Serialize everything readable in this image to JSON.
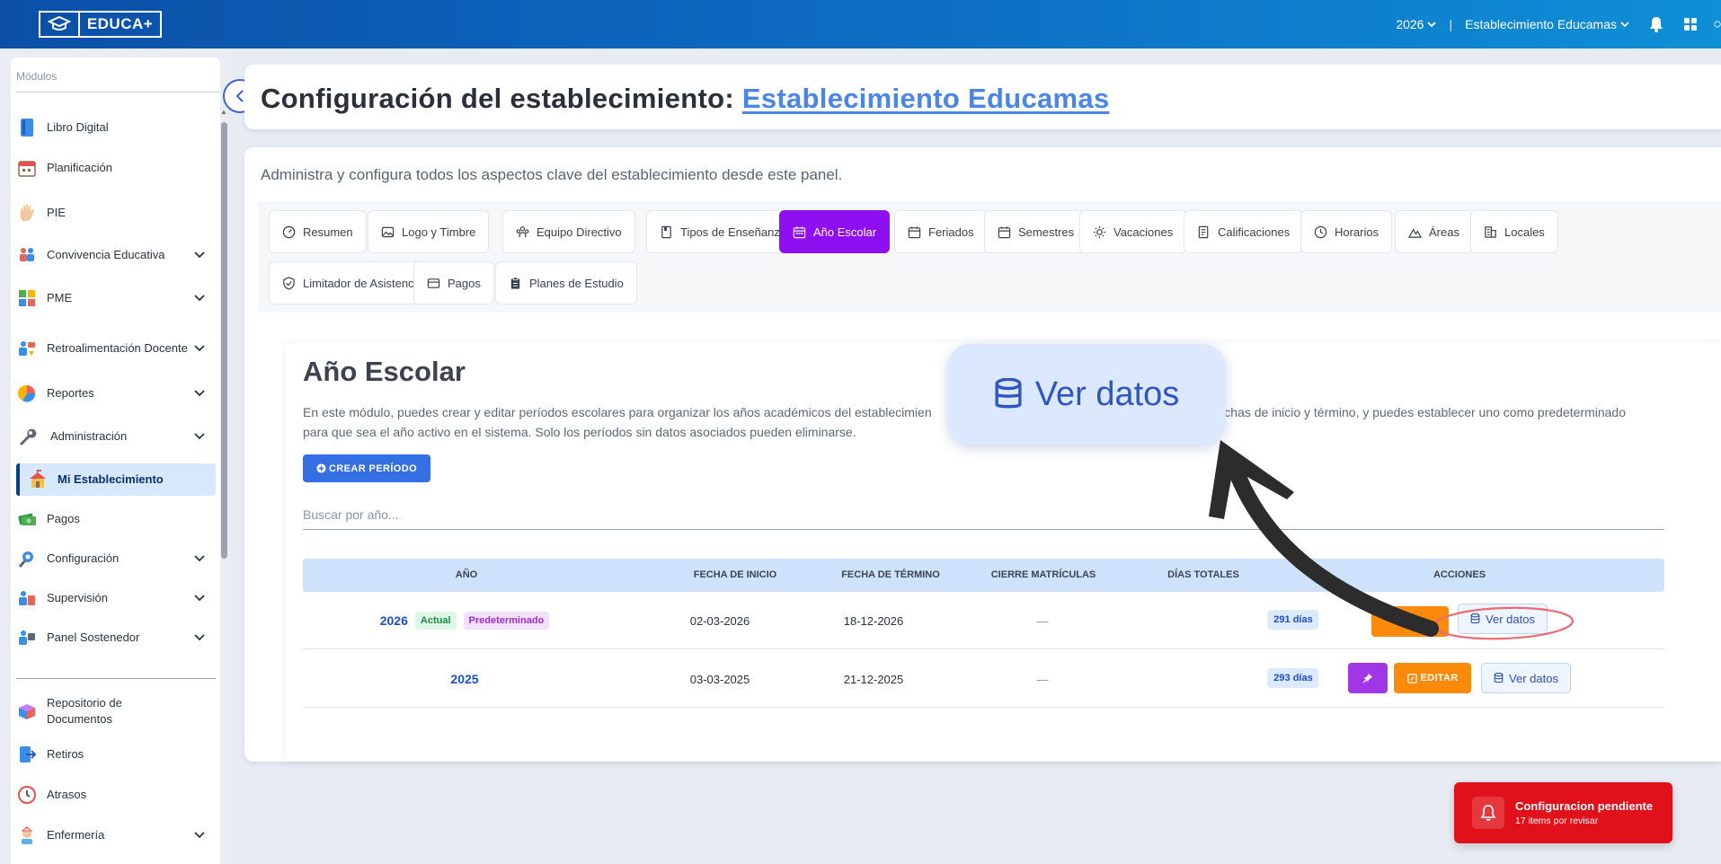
{
  "topbar": {
    "logo_text": "EDUCA+",
    "year": "2026",
    "separator": "|",
    "establishment": "Establecimiento Educamas"
  },
  "sidebar": {
    "section_title": "Módulos",
    "items": [
      {
        "label": "Libro Digital",
        "icon": "book-icon",
        "chevron": false
      },
      {
        "label": "Planificación",
        "icon": "calendar-icon",
        "chevron": false
      },
      {
        "label": "PIE",
        "icon": "hand-icon",
        "chevron": false
      },
      {
        "label": "Convivencia Educativa",
        "icon": "people-icon",
        "chevron": true
      },
      {
        "label": "PME",
        "icon": "blocks-icon",
        "chevron": true
      },
      {
        "label": "Retroalimentación Docente",
        "icon": "feedback-icon",
        "chevron": true
      },
      {
        "label": "Reportes",
        "icon": "pie-chart-icon",
        "chevron": true
      },
      {
        "label": "Administración",
        "icon": "wrench-icon",
        "chevron": true
      },
      {
        "label": "Mi Establecimiento",
        "icon": "school-icon",
        "chevron": false,
        "active": true
      },
      {
        "label": "Pagos",
        "icon": "money-icon",
        "chevron": false
      },
      {
        "label": "Configuración",
        "icon": "config-icon",
        "chevron": true
      },
      {
        "label": "Supervisión",
        "icon": "supervision-icon",
        "chevron": true
      },
      {
        "label": "Panel Sostenedor",
        "icon": "panel-icon",
        "chevron": true
      },
      {
        "label": "Repositorio de Documentos",
        "icon": "box-icon",
        "chevron": false
      },
      {
        "label": "Retiros",
        "icon": "exit-icon",
        "chevron": false
      },
      {
        "label": "Atrasos",
        "icon": "clock-icon",
        "chevron": false
      },
      {
        "label": "Enfermería",
        "icon": "nurse-icon",
        "chevron": true
      }
    ]
  },
  "header": {
    "title_prefix": "Configuración del establecimiento:",
    "title_link": "Establecimiento Educamas"
  },
  "main": {
    "subtitle": "Administra y configura todos los aspectos clave del establecimiento desde este panel.",
    "tabs": [
      {
        "label": "Resumen"
      },
      {
        "label": "Logo y Timbre"
      },
      {
        "label": "Equipo Directivo"
      },
      {
        "label": "Tipos de Enseñanza"
      },
      {
        "label": "Año Escolar",
        "active": true
      },
      {
        "label": "Feriados"
      },
      {
        "label": "Semestres"
      },
      {
        "label": "Vacaciones"
      },
      {
        "label": "Calificaciones"
      },
      {
        "label": "Horarios"
      },
      {
        "label": "Áreas"
      },
      {
        "label": "Locales"
      },
      {
        "label": "Limitador de Asistencia"
      },
      {
        "label": "Pagos"
      },
      {
        "label": "Planes de Estudio"
      }
    ],
    "section": {
      "title": "Año Escolar",
      "desc_part1": "En este módulo, puedes crear y editar períodos escolares para organizar los años académicos del establecimien",
      "desc_part2": "fechas de inicio y término, y puedes establecer uno como predeterminado",
      "desc_line2": "para que sea el año activo en el sistema. Solo los períodos sin datos asociados pueden eliminarse.",
      "create_button": "CREAR PERÍODO",
      "search_placeholder": "Buscar por año...",
      "columns": [
        "AÑO",
        "FECHA DE INICIO",
        "FECHA DE TÉRMINO",
        "CIERRE MATRÍCULAS",
        "DÍAS TOTALES",
        "ACCIONES"
      ],
      "rows": [
        {
          "year": "2026",
          "badge_actual": "Actual",
          "badge_default": "Predeterminado",
          "start": "02-03-2026",
          "end": "18-12-2026",
          "closing": "—",
          "days": "291 días",
          "view_label": "Ver datos"
        },
        {
          "year": "2025",
          "start": "03-03-2025",
          "end": "21-12-2025",
          "closing": "—",
          "days": "293 días",
          "edit_label": "EDITAR",
          "view_label": "Ver datos"
        }
      ]
    }
  },
  "callout": {
    "label": "Ver datos"
  },
  "toast": {
    "title": "Configuracion pendiente",
    "subtitle": "17 items por revisar"
  },
  "colors": {
    "accent_purple": "#8e0ff0",
    "brand_blue": "#0b4fa8",
    "orange": "#fb8a0a",
    "toast_red": "#e0111a"
  }
}
